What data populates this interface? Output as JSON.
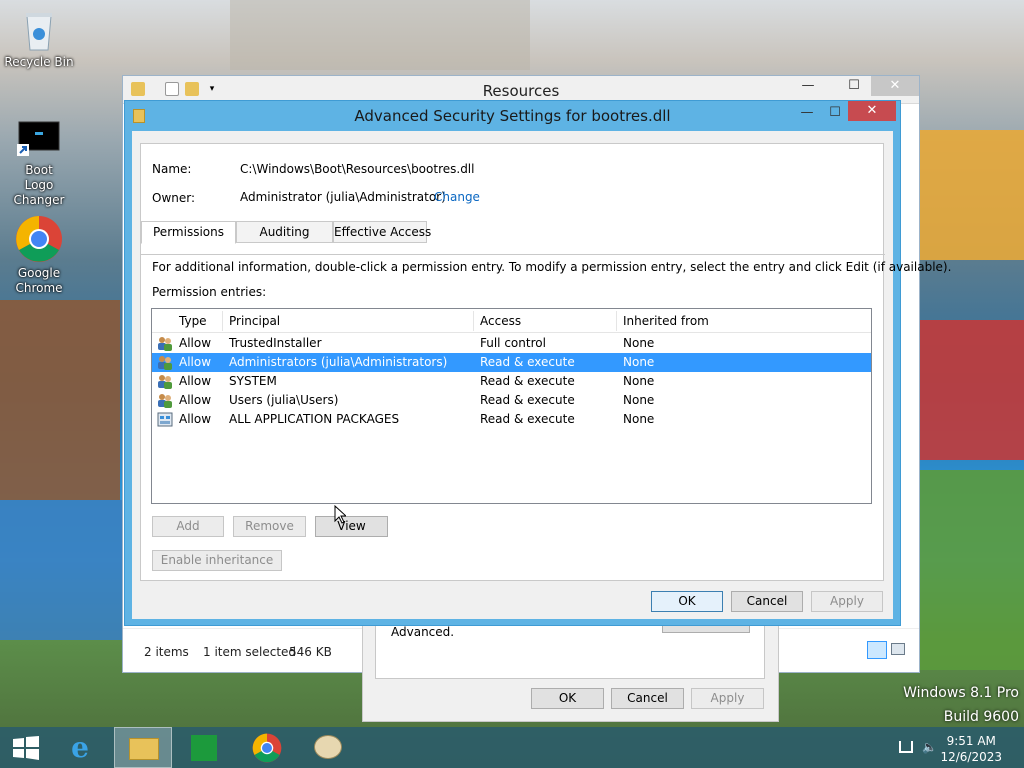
{
  "desktop": {
    "icons": [
      {
        "label": "Recycle Bin"
      },
      {
        "label": "Boot Logo Changer"
      },
      {
        "label": "Google Chrome"
      }
    ],
    "watermark": {
      "line1": "Windows 8.1 Pro",
      "line2": "Build 9600"
    }
  },
  "explorer": {
    "title": "Resources",
    "status": {
      "items": "2 items",
      "selected": "1 item selected",
      "size": "546 KB"
    }
  },
  "behind_dialog": {
    "text": "Advanced.",
    "ok": "OK",
    "cancel": "Cancel",
    "apply": "Apply"
  },
  "dialog": {
    "title": "Advanced Security Settings for bootres.dll",
    "name_label": "Name:",
    "name_value": "C:\\Windows\\Boot\\Resources\\bootres.dll",
    "owner_label": "Owner:",
    "owner_value": "Administrator (julia\\Administrator)",
    "change_link": "Change",
    "tabs": [
      "Permissions",
      "Auditing",
      "Effective Access"
    ],
    "info_text": "For additional information, double-click a permission entry. To modify a permission entry, select the entry and click Edit (if available).",
    "entries_label": "Permission entries:",
    "columns": [
      "Type",
      "Principal",
      "Access",
      "Inherited from"
    ],
    "rows": [
      {
        "type": "Allow",
        "principal": "TrustedInstaller",
        "access": "Full control",
        "inherited": "None",
        "icon": "users-icon"
      },
      {
        "type": "Allow",
        "principal": "Administrators (julia\\Administrators)",
        "access": "Read & execute",
        "inherited": "None",
        "icon": "users-icon"
      },
      {
        "type": "Allow",
        "principal": "SYSTEM",
        "access": "Read & execute",
        "inherited": "None",
        "icon": "users-icon"
      },
      {
        "type": "Allow",
        "principal": "Users (julia\\Users)",
        "access": "Read & execute",
        "inherited": "None",
        "icon": "users-icon"
      },
      {
        "type": "Allow",
        "principal": "ALL APPLICATION PACKAGES",
        "access": "Read & execute",
        "inherited": "None",
        "icon": "package-icon"
      }
    ],
    "selected_row": 1,
    "buttons": {
      "add": "Add",
      "remove": "Remove",
      "view": "View",
      "enable_inheritance": "Enable inheritance"
    },
    "footer": {
      "ok": "OK",
      "cancel": "Cancel",
      "apply": "Apply"
    }
  },
  "taskbar": {
    "clock": {
      "time": "9:51 AM",
      "date": "12/6/2023"
    }
  },
  "colors": {
    "selection": "#3399ff",
    "dialog_frame": "#5eb3e4",
    "close_red": "#c74b50",
    "link": "#0a67c2"
  }
}
